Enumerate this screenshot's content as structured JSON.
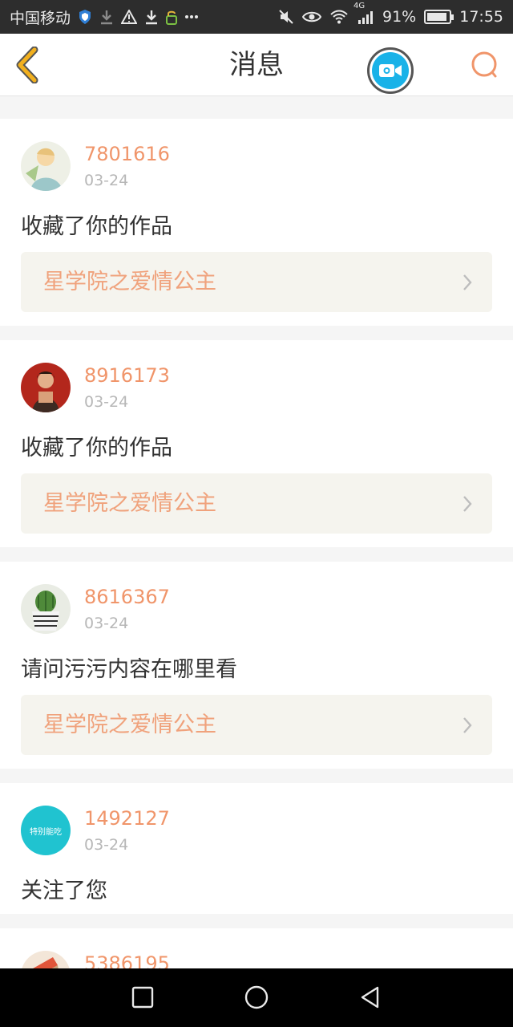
{
  "status_bar": {
    "carrier": "中国移动",
    "network": "4G",
    "battery_percent": "91%",
    "battery_level": 0.91,
    "time": "17:55",
    "icons": [
      "shield-icon",
      "download-icon",
      "warning-icon",
      "download-icon",
      "lock-icon",
      "more-icon",
      "mute-icon",
      "eye-icon",
      "wifi-icon",
      "signal-icon",
      "battery-icon"
    ]
  },
  "header": {
    "title": "消息",
    "back_icon": "chevron-left-icon",
    "video_icon": "video-camera-icon",
    "search_icon": "search-icon"
  },
  "colors": {
    "accent": "#f0956a",
    "work_title": "#f0a27c",
    "video_blue": "#19b2e8",
    "back_yellow": "#f2b01e"
  },
  "messages": [
    {
      "username": "7801616",
      "date": "03-24",
      "text": "收藏了你的作品",
      "work_title": "星学院之爱情公主"
    },
    {
      "username": "8916173",
      "date": "03-24",
      "text": "收藏了你的作品",
      "work_title": "星学院之爱情公主"
    },
    {
      "username": "8616367",
      "date": "03-24",
      "text": "请问污污内容在哪里看",
      "work_title": "星学院之爱情公主"
    },
    {
      "username": "1492127",
      "date": "03-24",
      "text": "关注了您",
      "avatar_text": "特别能吃"
    },
    {
      "username": "5386195"
    }
  ],
  "nav": {
    "icons": [
      "recent-apps-icon",
      "home-icon",
      "back-icon"
    ]
  }
}
